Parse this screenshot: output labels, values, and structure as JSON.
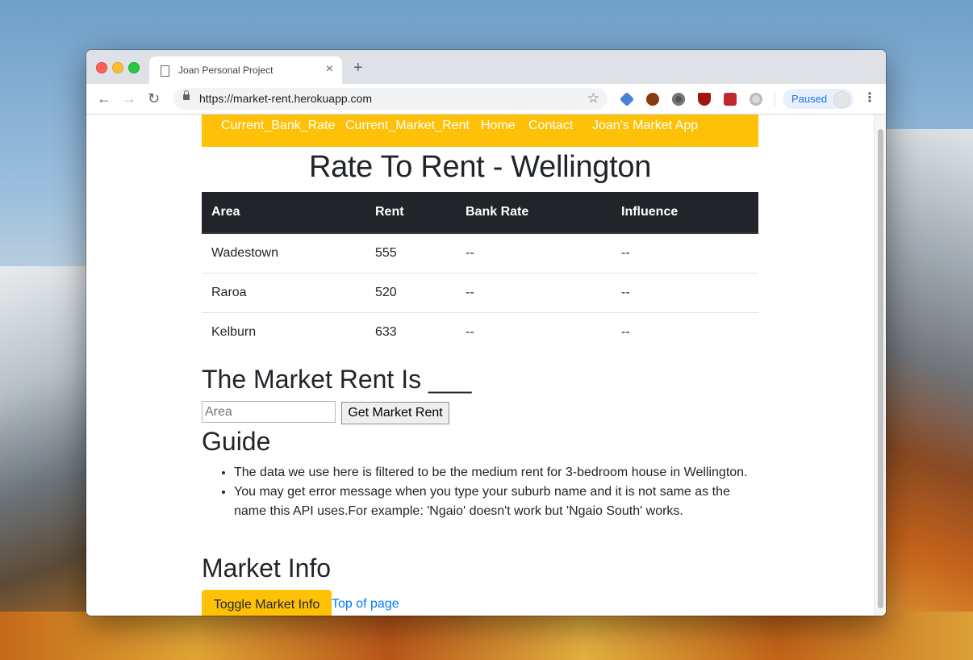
{
  "browser": {
    "tab_title": "Joan Personal Project",
    "tab_close": "×",
    "new_tab": "+",
    "url": "https://market-rent.herokuapp.com",
    "profile_status": "Paused",
    "icons": {
      "back": "←",
      "forward": "→",
      "reload": "↻",
      "star": "☆",
      "menu": "⋮"
    }
  },
  "navbar": {
    "links": [
      "Current_Bank_Rate",
      "Current_Market_Rent",
      "Home",
      "Contact"
    ],
    "brand": "Joan's Market App",
    "color": "#ffc107"
  },
  "page": {
    "title": "Rate To Rent - Wellington"
  },
  "table": {
    "headers": [
      "Area",
      "Rent",
      "Bank Rate",
      "Influence"
    ],
    "rows": [
      [
        "Wadestown",
        "555",
        "--",
        "--"
      ],
      [
        "Raroa",
        "520",
        "--",
        "--"
      ],
      [
        "Kelburn",
        "633",
        "--",
        "--"
      ]
    ]
  },
  "market_rent": {
    "heading": "The Market Rent Is ___",
    "input_placeholder": "Area",
    "button_label": "Get Market Rent"
  },
  "guide": {
    "heading": "Guide",
    "items": [
      "The data we use here is filtered to be the medium rent for 3-bedroom house in Wellington.",
      "You may get error message when you type your suburb name and it is not same as the name this API uses.For example: 'Ngaio' doesn't work but 'Ngaio South' works."
    ]
  },
  "market_info": {
    "heading": "Market Info",
    "toggle_label": "Toggle Market Info",
    "top_link": "Top of page"
  }
}
